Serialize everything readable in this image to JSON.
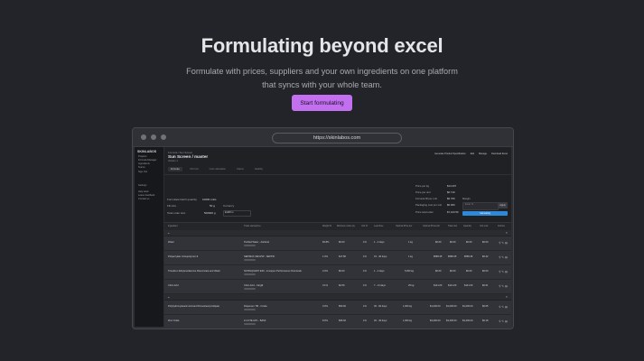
{
  "hero": {
    "title": "Formulating beyond excel",
    "subtitle": "Formulate with prices, suppliers and your own ingredients on one platform that syncs with your whole team.",
    "cta_label": "Start formulating"
  },
  "browser": {
    "url": "https://skinlabos.com"
  },
  "app": {
    "sidebar": {
      "brand": "SKINLABOS",
      "items": [
        "Projects",
        "Formula Manager",
        "Ingredients",
        "Teams",
        "Sign Out",
        "Settings",
        "Help desk",
        "Leave feedback",
        "Contact us"
      ]
    },
    "breadcrumb": "Formula / Sun Screen",
    "title": "Sun Screen / master",
    "version": "Version 1",
    "tabs": [
      "Formula",
      "INCI list",
      "Cost calculation",
      "Claims",
      "Stability"
    ],
    "top_actions": [
      "Generate Product Specification",
      "Edit",
      "Manage",
      "Download Excel"
    ],
    "form": {
      "batch_label": "Formulate batch quantity",
      "batch_value": "10000 units",
      "fill_label": "Fill size",
      "fill_value": "50 g",
      "total_label": "Total order size",
      "total_value": "500000 g",
      "currency_label": "Currency",
      "currency_value": "EURO"
    },
    "summary": [
      {
        "label": "Price per kg",
        "value": "$14.207"
      },
      {
        "label": "Price per unit",
        "value": "$0.710"
      },
      {
        "label": "Formula fill per unit",
        "value": "$0.700"
      },
      {
        "label": "Packaging cost per unit",
        "value": "$0.000"
      },
      {
        "label": "Price total order",
        "value": "$7,103.50"
      }
    ],
    "margin_label": "Margin",
    "margin_placeholder": "Enter %",
    "margin_button": "Apply",
    "blue_bar_label": "Calculating",
    "table_headers": [
      "Ingredient",
      "Trade name/price",
      "Weight %",
      "Minimum order qty",
      "Unit %",
      "Lead time",
      "Optimal Price tier",
      "Optimal Price/unit",
      "Total cost",
      "Quantity",
      "Unit cost",
      "Actions"
    ],
    "phases": [
      {
        "rows": [
          {
            "ingredient": "Water",
            "trade": "Purified Water - Ashland",
            "weight": "82.8%",
            "moq": "$0.00",
            "unit": "1%",
            "lead": "1 - 4 days",
            "tier": "1 kg",
            "ppu": "$0.00",
            "total": "$0.00",
            "qty": "$0.00",
            "unitcost": "$0.00"
          },
          {
            "ingredient": "Polyacrylate Crosspolymer-6",
            "trade": "SEPIMAX ZEN-PW - SEPPIC",
            "weight": "1.0%",
            "moq": "$17.80",
            "unit": "1%",
            "lead": "15 - 30 days",
            "tier": "1 kg",
            "ppu": "$589.35",
            "total": "$589.35",
            "qty": "$589.35",
            "unitcost": "$0.22"
          },
          {
            "ingredient": "Trisodium Ethylenediamine Disuccinate and Water",
            "trade": "NATRLQUEST E30 - Innospec Performance Chemicals",
            "weight": "2.0%",
            "moq": "$0.00",
            "unit": "1%",
            "lead": "1 - 4 days",
            "tier": "5,000 kg",
            "ppu": "$0.00",
            "total": "$0.00",
            "qty": "$0.00",
            "unitcost": "$0.00"
          },
          {
            "ingredient": "Citric Acid",
            "trade": "Citric Acid - Cargill",
            "weight": "0.1%",
            "moq": "$2.50",
            "unit": "1%",
            "lead": "7 - 14 days",
            "tier": "25 kg",
            "ppu": "$141.00",
            "total": "$141.00",
            "qty": "$141.00",
            "unitcost": "$0.01"
          }
        ]
      },
      {
        "rows": [
          {
            "ingredient": "Polyhydroxystearic Acid and Di-Isostearyl Adipate",
            "trade": "Dispersun TM - Croda",
            "weight": "3.0%",
            "moq": "$50.00",
            "unit": "1%",
            "lead": "30 - 60 days",
            "tier": "1,000 kg",
            "ppu": "$1,000.00",
            "total": "$1,000.00",
            "qty": "$1,000.00",
            "unitcost": "$0.05"
          },
          {
            "ingredient": "Zinc Oxide",
            "trade": "Z-COTE HP1 - BASF",
            "weight": "8.0%",
            "moq": "$95.00",
            "unit": "1%",
            "lead": "20 - 40 days",
            "tier": "1,000 kg",
            "ppu": "$3,400.00",
            "total": "$3,400.00",
            "qty": "$3,400.00",
            "unitcost": "$0.18"
          }
        ]
      }
    ],
    "colors": {
      "accent": "#c26ff0",
      "background": "#222429",
      "progress_blue": "#2f89d9"
    }
  }
}
